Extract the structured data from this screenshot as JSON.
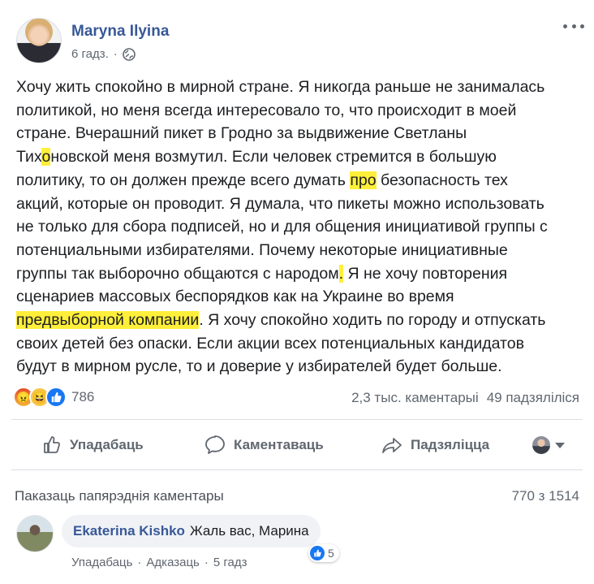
{
  "post": {
    "author": "Maryna Ilyina",
    "time": "6 гадз.",
    "separator": "·",
    "text": {
      "l1": "Хочу жить спокойно в мирной стране. Я никогда раньше не занималась",
      "l2": "политикой, но меня всегда интересовало то, что происходит в моей",
      "l3": "стране. Вчерашний пикет в Гродно за выдвижение Светланы",
      "l4a": "Тих",
      "l4hl": "о",
      "l4b": "новской меня возмутил. Если человек стремится в большую",
      "l5a": "политику, то он должен прежде всего думать ",
      "l5hl": "про",
      "l5b": " безопасность тех",
      "l6": "акций, которые он проводит. Я думала, что пикеты можно использовать",
      "l7": "не только для сбора подписей, но и для общения инициативой группы с",
      "l8": "потенциальными избирателями. Почему некоторые инициативные",
      "l9a": "группы так выборочно общаются с народом",
      "l9hl": ".",
      "l9b": " Я не хочу повторения",
      "l10": "сценариев массовых беспорядков как на Украине во время",
      "l11hl": "предвыборной компании",
      "l11b": ". Я хочу спокойно ходить по городу и отпускать",
      "l12": "своих детей без опаски. Если акции всех потенциальных кандидатов",
      "l13": "будут в мирном русле, то и доверие у избирателей будет больше."
    },
    "highlight_color": "#ffef3a"
  },
  "stats": {
    "reaction_count": "786",
    "comments": "2,3 тыс. каментарыі",
    "shares": "49 падзяліліся"
  },
  "actions": {
    "like": "Упадабаць",
    "comment": "Каментаваць",
    "share": "Падзяліцца"
  },
  "comments_section": {
    "show_previous": "Паказаць папярэднія каментары",
    "pager": "770 з 1514",
    "comment": {
      "author": "Ekaterina Kishko",
      "text": "Жаль вас, Марина",
      "like_count": "5",
      "like_link": "Упадабаць",
      "reply_link": "Адказаць",
      "time": "5 гадз",
      "separator": "·"
    }
  },
  "colors": {
    "link": "#385898",
    "secondary_text": "#606770",
    "like_blue": "#1877f2"
  }
}
